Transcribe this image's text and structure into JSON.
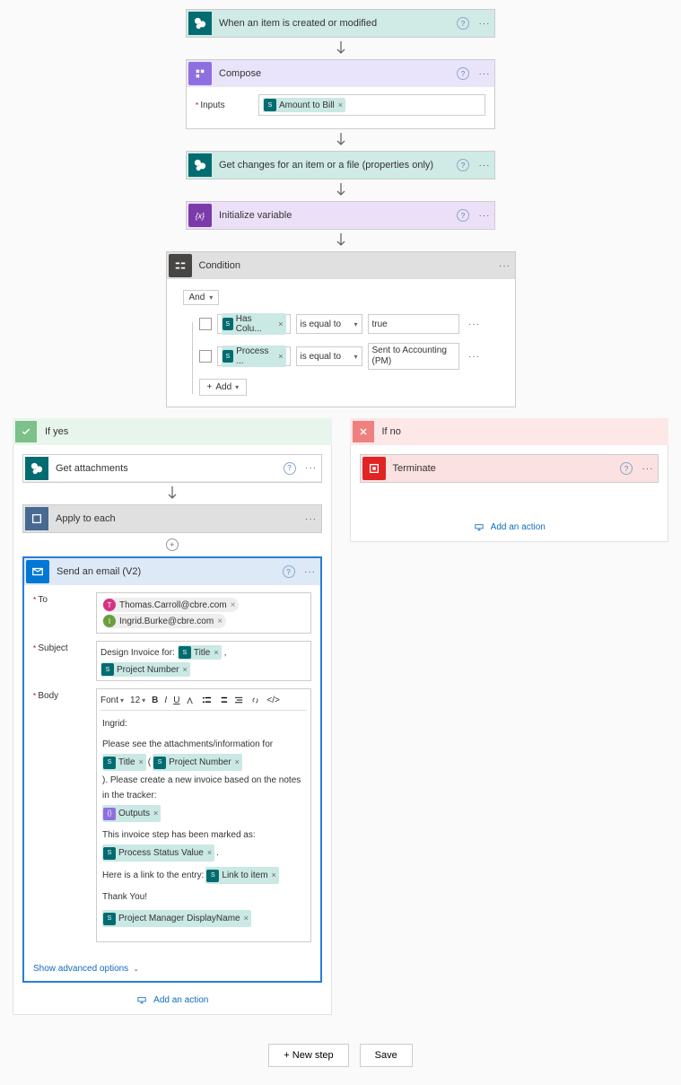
{
  "steps": {
    "trigger": "When an item is created or modified",
    "compose": "Compose",
    "compose_inputs_label": "Inputs",
    "compose_token": "Amount to Bill",
    "getchanges": "Get changes for an item or a file (properties only)",
    "initvar": "Initialize variable",
    "condition": "Condition"
  },
  "condition": {
    "group": "And",
    "rows": [
      {
        "field": "Has Colu...",
        "op": "is equal to",
        "value": "true"
      },
      {
        "field": "Process ...",
        "op": "is equal to",
        "value": "Sent to Accounting (PM)"
      }
    ],
    "add": "Add"
  },
  "branches": {
    "yes": "If yes",
    "no": "If no",
    "getattach": "Get attachments",
    "apply": "Apply to each",
    "terminate": "Terminate",
    "addaction": "Add an action"
  },
  "email": {
    "title": "Send an email (V2)",
    "to_label": "To",
    "subject_label": "Subject",
    "body_label": "Body",
    "to": [
      {
        "initial": "T",
        "addr": "Thomas.Carroll@cbre.com"
      },
      {
        "initial": "I",
        "addr": "Ingrid.Burke@cbre.com"
      }
    ],
    "subject_prefix": "Design Invoice for:",
    "subject_tokens": [
      "Title",
      "Project Number"
    ],
    "toolbar": {
      "font": "Font",
      "size": "12"
    },
    "body": {
      "greet": "Ingrid:",
      "l1a": "Please see the attachments/information for",
      "tok_title": "Title",
      "l1b": "(",
      "tok_pn": "Project Number",
      "l1c": "). Please create a new invoice based on the notes in the tracker:",
      "tok_out": "Outputs",
      "l2": "This invoice step has been marked as:",
      "tok_psv": "Process Status Value",
      "l3": "Here is a link to the entry:",
      "tok_link": "Link to item",
      "l4": "Thank You!",
      "tok_pm": "Project Manager DisplayName"
    },
    "advanced": "Show advanced options"
  },
  "footer": {
    "newstep": "+ New step",
    "save": "Save"
  }
}
